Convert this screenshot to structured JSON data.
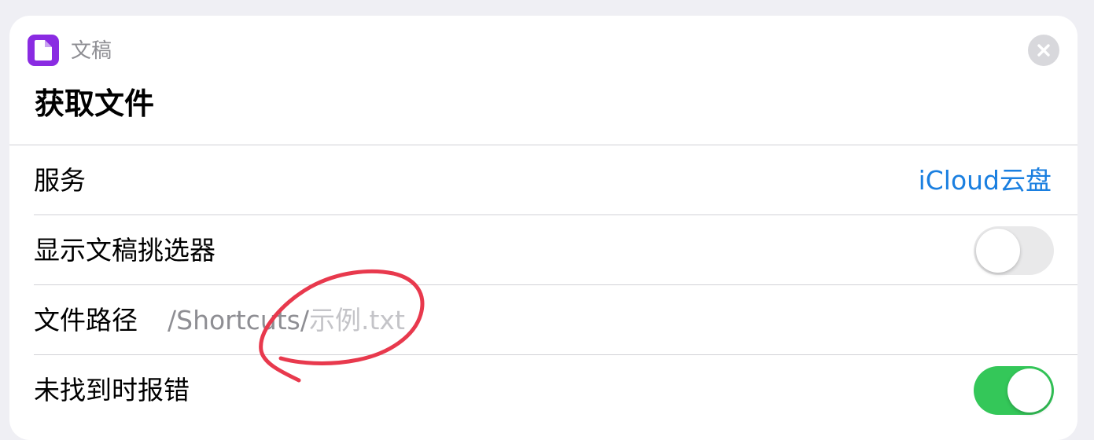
{
  "header": {
    "app_name": "文稿",
    "app_icon": "document-icon",
    "action_title": "获取文件",
    "close_icon": "close-icon"
  },
  "rows": {
    "service": {
      "label": "服务",
      "value": "iCloud云盘"
    },
    "show_picker": {
      "label": "显示文稿挑选器",
      "toggle_on": false
    },
    "file_path": {
      "label": "文件路径",
      "value_prefix": "/Shortcuts/",
      "value_placeholder": "示例.txt"
    },
    "error_not_found": {
      "label": "未找到时报错",
      "toggle_on": true
    }
  },
  "colors": {
    "app_icon": "#8a2be2",
    "link": "#1a7fe0",
    "toggle_on": "#34c759",
    "annotation": "#e8394d"
  }
}
